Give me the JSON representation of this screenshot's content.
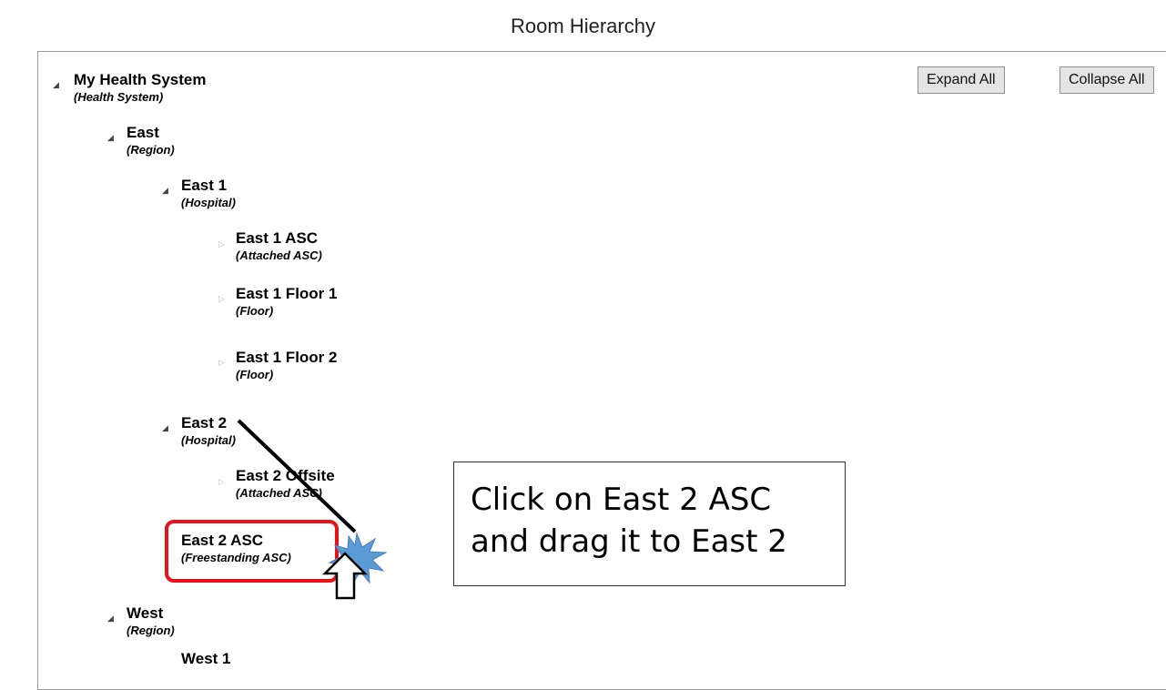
{
  "page": {
    "title": "Room Hierarchy"
  },
  "toolbar": {
    "expand_all": "Expand All",
    "collapse_all": "Collapse All"
  },
  "tree": [
    {
      "name": "My Health System",
      "type": "(Health System)"
    },
    {
      "name": "East",
      "type": "(Region)"
    },
    {
      "name": "East 1",
      "type": "(Hospital)"
    },
    {
      "name": "East 1 ASC",
      "type": "(Attached ASC)"
    },
    {
      "name": "East 1 Floor 1",
      "type": "(Floor)"
    },
    {
      "name": "East 1 Floor 2",
      "type": "(Floor)"
    },
    {
      "name": "East 2",
      "type": "(Hospital)"
    },
    {
      "name": "East 2 Offsite",
      "type": "(Attached ASC)"
    },
    {
      "name": "East 2 ASC",
      "type": "(Freestanding ASC)"
    },
    {
      "name": "West",
      "type": "(Region)"
    },
    {
      "name": "West 1",
      "type": ""
    }
  ],
  "callout": {
    "line1": "Click on East 2 ASC",
    "line2": "and drag it to East 2"
  },
  "colors": {
    "highlight": "#e8121a",
    "burst": "#5b9bd5"
  }
}
